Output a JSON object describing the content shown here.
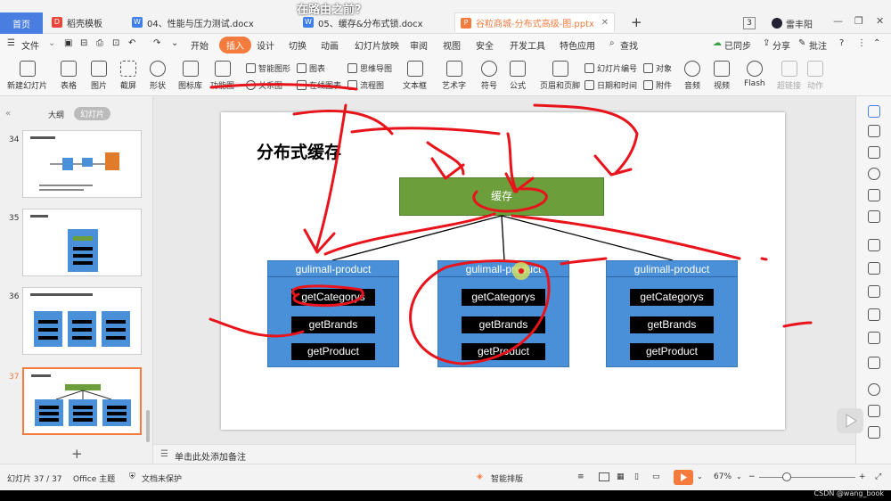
{
  "caption": "在路由之前?",
  "tabs": {
    "home": "首页",
    "t1": "稻壳模板",
    "t2": "04、性能与压力测试.docx",
    "t3": "05、缓存&分布式锁.docx",
    "t4": "谷粒商城-分布式高级-图.pptx",
    "new": "+",
    "user": "雷丰阳",
    "count": "3"
  },
  "menu": {
    "file": "文件",
    "items": [
      "开始",
      "插入",
      "设计",
      "切换",
      "动画",
      "幻灯片放映",
      "审阅",
      "视图",
      "安全",
      "开发工具",
      "特色应用"
    ],
    "search": "查找",
    "sync": "已同步",
    "share": "分享",
    "comment": "批注"
  },
  "ribbon": {
    "new_slide": "新建幻灯片",
    "table": "表格",
    "picture": "图片",
    "screenshot": "截屏",
    "shape": "形状",
    "icons": "图标库",
    "func": "功能图",
    "smart": "智能图形",
    "chart": "图表",
    "relation": "关系图",
    "online_chart": "在线图表",
    "mind": "思维导图",
    "flow": "流程图",
    "textbox": "文本框",
    "art": "艺术字",
    "symbol": "符号",
    "formula": "公式",
    "header_footer": "页眉和页脚",
    "slide_no": "幻灯片编号",
    "date_time": "日期和时间",
    "object": "对象",
    "attach": "附件",
    "audio": "音频",
    "video": "视频",
    "flash": "Flash",
    "hyperlink": "超链接",
    "action": "动作"
  },
  "leftpanel": {
    "outline": "大纲",
    "slides": "幻灯片",
    "nums": [
      "34",
      "35",
      "36",
      "37"
    ],
    "add": "+"
  },
  "slide": {
    "title": "分布式缓存",
    "cache": "缓存",
    "products": [
      {
        "name": "gulimall-product",
        "methods": [
          "getCategorys",
          "getBrands",
          "getProduct"
        ]
      },
      {
        "name": "gulimall-product",
        "methods": [
          "getCategorys",
          "getBrands",
          "getProduct"
        ]
      },
      {
        "name": "gulimall-product",
        "methods": [
          "getCategorys",
          "getBrands",
          "getProduct"
        ]
      }
    ]
  },
  "notes": "单击此处添加备注",
  "status": {
    "slide_info": "幻灯片 37 / 37",
    "theme": "Office 主题",
    "protect": "文档未保护",
    "smart_layout": "智能排版",
    "zoom": "67%"
  },
  "watermark": "CSDN @wang_book",
  "colors": {
    "accent": "#f47a3d",
    "home_tab": "#4a7de0",
    "box_blue": "#4a90d9",
    "cache_green": "#6c9e3c",
    "annotation_red": "#e8131b"
  }
}
